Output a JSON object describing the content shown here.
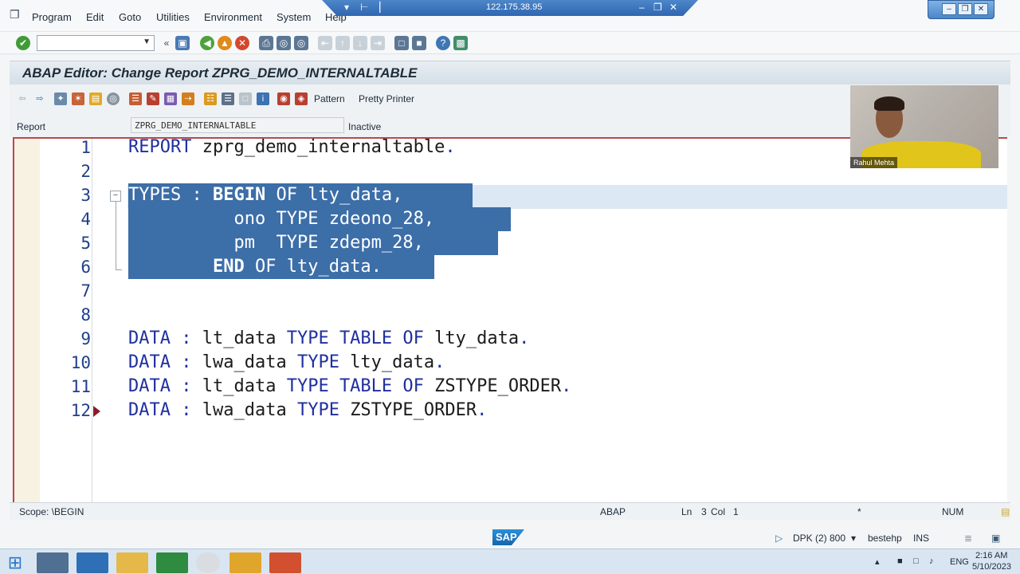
{
  "menubar": {
    "items": [
      "Program",
      "Edit",
      "Goto",
      "Utilities",
      "Environment",
      "System",
      "Help"
    ]
  },
  "remote_session": {
    "address": "122.175.38.95"
  },
  "toolbar": {
    "command_field_value": ""
  },
  "window": {
    "title": "ABAP Editor: Change Report ZPRG_DEMO_INTERNALTABLE"
  },
  "app_toolbar": {
    "pattern_label": "Pattern",
    "pretty_printer_label": "Pretty Printer"
  },
  "report": {
    "label": "Report",
    "name": "ZPRG_DEMO_INTERNALTABLE",
    "status": "Inactive"
  },
  "editor": {
    "line_numbers": [
      "1",
      "2",
      "3",
      "4",
      "5",
      "6",
      "7",
      "8",
      "9",
      "10",
      "11",
      "12"
    ],
    "lines": [
      "REPORT zprg_demo_internaltable.",
      "",
      "TYPES : BEGIN OF lty_data,",
      "          ono TYPE zdeono_28,",
      "          pm  TYPE zdepm_28,",
      "        END OF lty_data.",
      "",
      "",
      "DATA : lt_data TYPE TABLE OF lty_data.",
      "DATA : lwa_data TYPE lty_data.",
      "DATA : lt_data TYPE TABLE OF ZSTYPE_ORDER.",
      "DATA : lwa_data TYPE ZSTYPE_ORDER."
    ]
  },
  "status": {
    "scope": "Scope: \\BEGIN",
    "language": "ABAP",
    "ln_label": "Ln",
    "ln_value": "3",
    "col_label": "Col",
    "col_value": "1",
    "modified": "*",
    "num": "NUM"
  },
  "session": {
    "system": "DPK (2) 800",
    "user": "bestehp",
    "mode": "INS"
  },
  "sap_logo": "SAP",
  "taskbar": {
    "lang": "ENG",
    "time": "2:16 AM",
    "date": "5/10/2023"
  },
  "webcam": {
    "name": "Rahul Mehta"
  },
  "colors": {
    "keyword": "#1f2fa0",
    "selection": "#3c6ea8",
    "title_bg": "#d6dfe7"
  }
}
